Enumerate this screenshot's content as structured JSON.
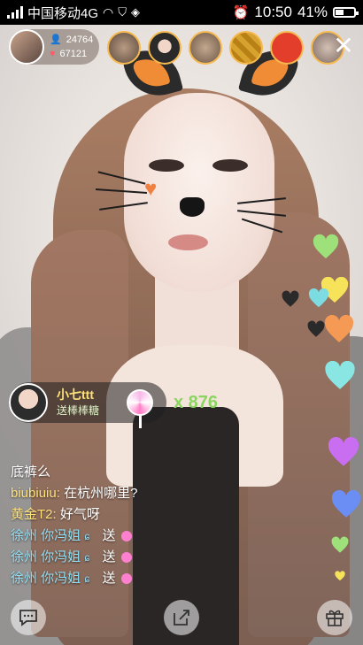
{
  "status_bar": {
    "carrier": "中国移动4G",
    "time": "10:50",
    "battery": "41%"
  },
  "host": {
    "viewer_count": "24764",
    "like_count": "67121"
  },
  "gift": {
    "sender": "小七ttt",
    "action": "送棒棒糖",
    "combo": "x 876"
  },
  "chat": [
    {
      "name": "",
      "text": "底裤么",
      "kind": "plain"
    },
    {
      "name": "biubiuiu:",
      "text": "在杭州哪里?",
      "kind": "message"
    },
    {
      "name": "黄金T2:",
      "text": "好气呀",
      "kind": "message"
    },
    {
      "name": "徐州 你冯姐",
      "text": "送",
      "kind": "gift"
    },
    {
      "name": "徐州 你冯姐",
      "text": "送",
      "kind": "gift"
    },
    {
      "name": "徐州 你冯姐",
      "text": "送",
      "kind": "gift"
    }
  ],
  "icons": {
    "close": "close-icon",
    "chat": "chat-bubble-icon",
    "share": "share-icon",
    "gift": "gift-icon"
  },
  "colors": {
    "gift_name": "#ffe27a",
    "chat_name_gold": "#ffe27a",
    "chat_name_blue": "#8fe0f6",
    "combo": "#8cd461"
  }
}
